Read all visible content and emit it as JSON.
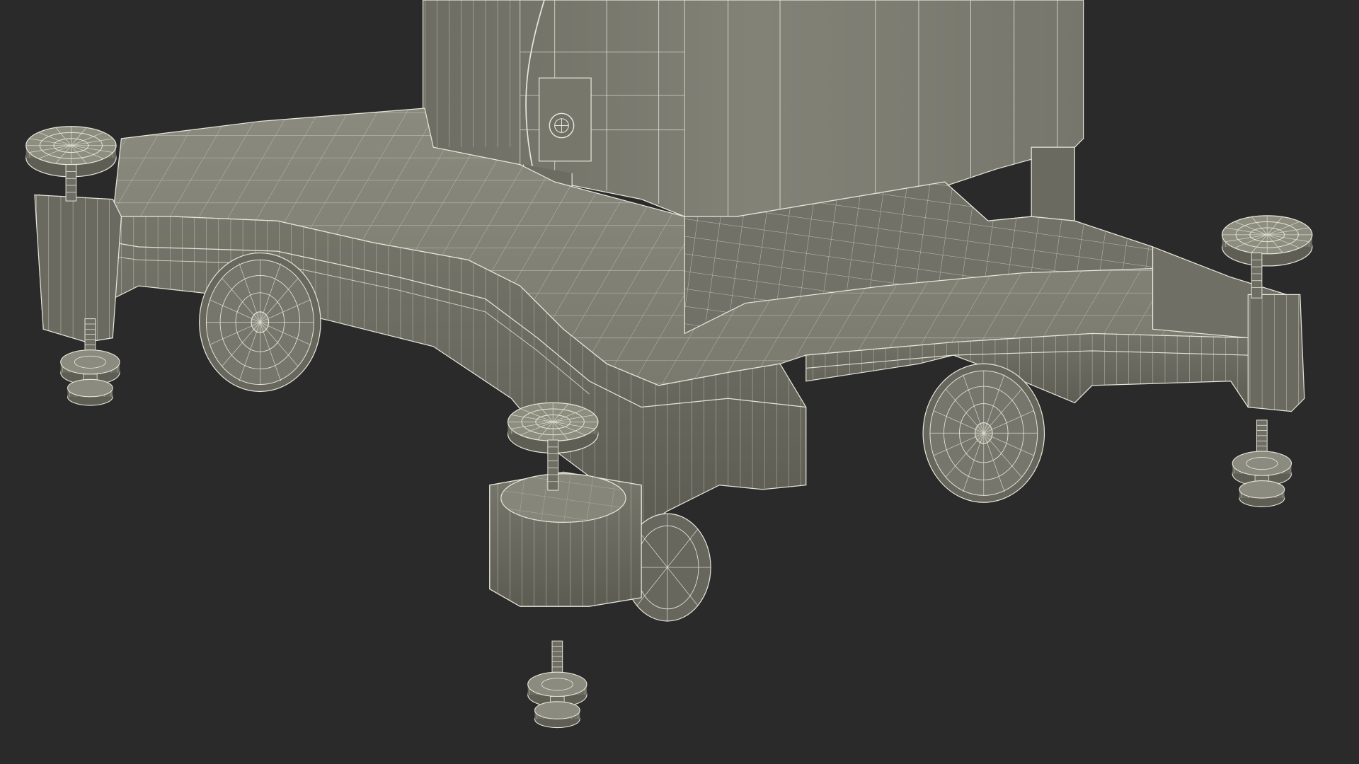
{
  "render": {
    "subject": "wireframe-render-of-medical-cart-base",
    "background_color": "#2a2a2a",
    "surface_color": "#7b7b70",
    "surface_light": "#8a8a7e",
    "surface_dark": "#5f5f55",
    "wire_color": "#e6e6da",
    "shadow_color": "#1c1c1c"
  }
}
